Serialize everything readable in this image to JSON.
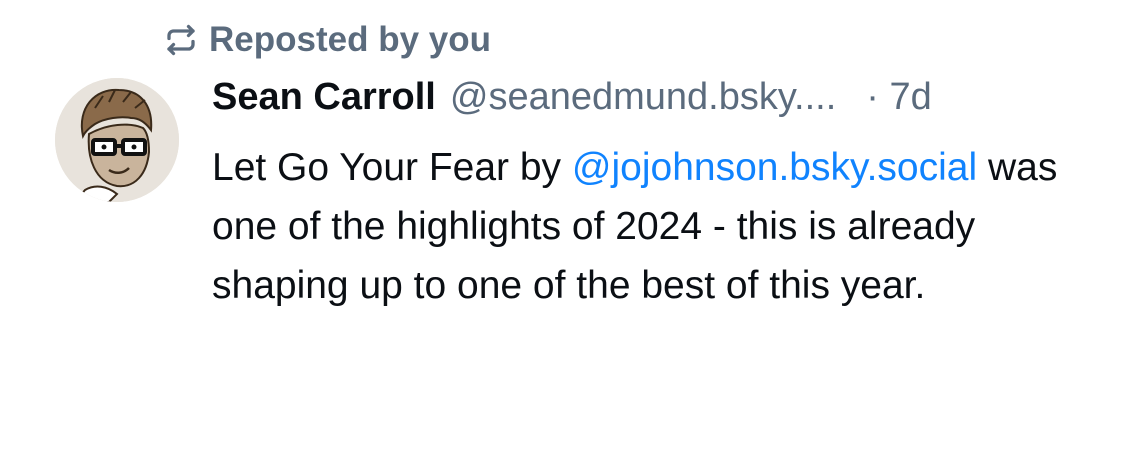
{
  "repost": {
    "label": "Reposted by you",
    "icon": "repost-icon"
  },
  "author": {
    "name": "Sean Carroll",
    "handle": "@seanedmund.bsky....",
    "time": "· 7d",
    "avatar": "cartoon-avatar"
  },
  "post": {
    "text_before": "Let Go Your Fear by ",
    "mention": "@jojohnson.bsky.social",
    "text_after": " was one of the highlights of 2024 - this is already shaping up to one of the best of this year."
  },
  "colors": {
    "muted": "#5b6b7d",
    "link": "#1083fe",
    "text": "#0b0f14"
  }
}
